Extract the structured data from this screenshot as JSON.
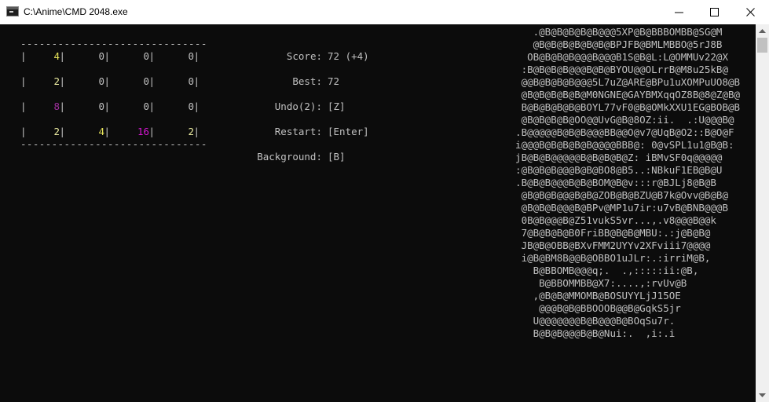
{
  "window": {
    "title": "C:\\Anime\\CMD 2048.exe",
    "minimize_icon": "minimize-icon",
    "maximize_icon": "maximize-icon",
    "close_icon": "close-icon"
  },
  "colors": {
    "console_bg": "#0c0c0c",
    "text": "#c0c0c0",
    "tile_2": "#eaeaa0",
    "tile_4": "#e6e35a",
    "tile_8": "#a0309e",
    "tile_16": "#d616d2"
  },
  "board": {
    "border": "------------------------------",
    "separator": "|",
    "rows": [
      [
        "4",
        "0",
        "0",
        "0"
      ],
      [
        "2",
        "0",
        "0",
        "0"
      ],
      [
        "8",
        "0",
        "0",
        "0"
      ],
      [
        "2",
        "4",
        "16",
        "2"
      ]
    ]
  },
  "menu": {
    "score_label": "Score:",
    "score_value": "72 (+4)",
    "best_label": "Best:",
    "best_value": "72",
    "undo_label": "Undo(2):",
    "undo_value": "[Z]",
    "restart_label": "Restart:",
    "restart_value": "[Enter]",
    "background_label": "Background:",
    "background_value": "[B]"
  },
  "ascii_art": [
    "     .@B@B@B@B@B@@@5XP@B@BBBOMBB@SG@M",
    "     @B@B@B@B@B@B@BPJFB@BMLMBBO@5rJ8B",
    "    OB@B@B@B@@@B@@@B1S@B@L:L@OMMUv22@X",
    "   :B@B@B@B@@@B@B@BYOU@@OLrrB@M8u25kB@",
    "   @@B@B@B@B@@@5L7uZ@ARE@BPu1uXOMPuUO8@B",
    "   @B@B@B@B@B@M0NGNE@GAYBMXqqOZ8B@8@Z@B@",
    "   B@B@B@B@B@BOYL77vF0@B@OMkXXU1EG@BOB@B",
    "   @B@B@B@B@OO@@UvG@B@8OZ:ii.  .:U@@@B@",
    "  .B@@@@@B@B@B@@@BB@@O@v7@UqB@O2::B@O@F",
    "  i@@@B@B@B@B@B@@@@BBB@: 0@vSPL1u1@B@B:",
    "  jB@B@B@@@@@B@B@B@B@Z: iBMvSF0q@@@@@",
    "  :@B@B@B@@@B@B@BO8@B5..:NBkuF1EB@B@U",
    "  .B@B@B@@@B@B@BOM@B@v:::r@BJLj8@B@B",
    "   @B@B@B@@@B@B@ZOB@B@BZU@B7k@Ovv@B@B@",
    "   @B@B@B@@@B@BPv@MP1u7ir:u7vB@BNB@@@B",
    "   0B@B@@@B@Z51vukS5vr...,.v8@@@B@@k",
    "   7@B@B@B@B0FriBB@B@B@MBU:.:j@B@B@",
    "   JB@B@OBB@BXvFMM2UYYv2XFviii7@@@@",
    "   i@B@BM8B@@B@OBBO1uJLr:.:irriM@B,",
    "     B@BBOMB@@@q;.  .,:::::ii:@B,",
    "      B@BBOMMBB@X7:....,:rvUv@B",
    "     ,@B@B@MMOMB@BOSUYYLjJ15OE",
    "      @@@B@B@BBOOOB@@B@GqkS5jr",
    "     U@@@@@@@B@B@@@B@BOqSu7r.",
    "     B@B@B@@@B@B@Nui:.  ,i:.i"
  ]
}
